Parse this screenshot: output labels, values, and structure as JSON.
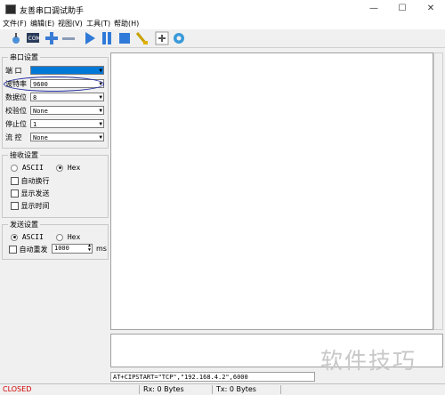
{
  "window": {
    "title": "友善串口调试助手",
    "minimize": "—",
    "maximize": "☐",
    "close": "✕"
  },
  "menu": [
    "文件(F)",
    "编辑(E)",
    "视图(V)",
    "工具(T)",
    "帮助(H)"
  ],
  "toolbar": [
    "new-icon",
    "com-icon",
    "plus-icon",
    "minus-icon",
    "play-icon",
    "pause-icon",
    "stop-icon",
    "clear-icon",
    "add-tab-icon",
    "settings-icon"
  ],
  "serial_settings": {
    "title": "串口设置",
    "rows": [
      {
        "label": "端  口",
        "value": ""
      },
      {
        "label": "波特率",
        "value": "9600"
      },
      {
        "label": "数据位",
        "value": "8"
      },
      {
        "label": "校验位",
        "value": "None"
      },
      {
        "label": "停止位",
        "value": "1"
      },
      {
        "label": "流  控",
        "value": "None"
      }
    ]
  },
  "recv_settings": {
    "title": "接收设置",
    "ascii": "ASCII",
    "hex": "Hex",
    "selected": "hex",
    "options": [
      "自动换行",
      "显示发送",
      "显示时间"
    ]
  },
  "send_settings": {
    "title": "发送设置",
    "ascii": "ASCII",
    "hex": "Hex",
    "selected": "ascii",
    "auto_resend": "自动重发",
    "interval": "1000",
    "unit": "ms"
  },
  "command": "AT+CIPSTART=\"TCP\",\"192.168.4.2\",6000",
  "status": {
    "state": "CLOSED",
    "rx": "Rx: 0 Bytes",
    "tx": "Tx: 0 Bytes",
    "state_color": "#d00000"
  },
  "watermark": "软件技巧"
}
